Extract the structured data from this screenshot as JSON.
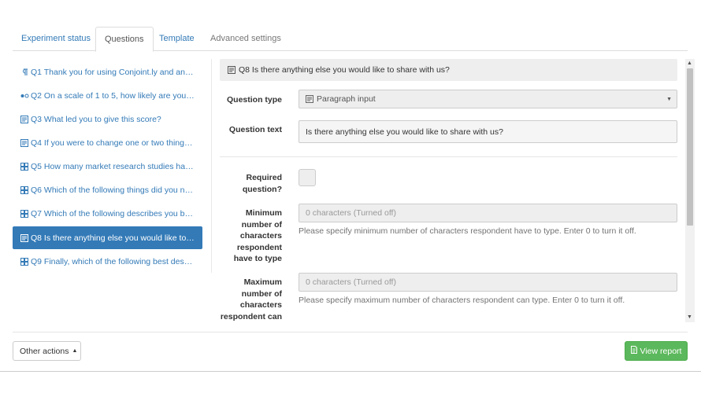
{
  "tabs": [
    {
      "label": "Experiment status"
    },
    {
      "label": "Questions"
    },
    {
      "label": "Template"
    },
    {
      "label": "Advanced settings"
    }
  ],
  "questions": [
    {
      "icon": "pilcrow-icon",
      "label": "Q1 Thank you for using Conjoint.ly and ans…"
    },
    {
      "icon": "scale-icon",
      "label": "Q2 On a scale of 1 to 5, how likely are you …"
    },
    {
      "icon": "paragraph-icon",
      "label": "Q3 What led you to give this score?"
    },
    {
      "icon": "paragraph-icon",
      "label": "Q4 If you were to change one or two things…"
    },
    {
      "icon": "choice-grid-icon",
      "label": "Q5 How many market research studies hav…"
    },
    {
      "icon": "choice-grid-icon",
      "label": "Q6 Which of the following things did you ne…"
    },
    {
      "icon": "choice-grid-icon",
      "label": "Q7 Which of the following describes you be…"
    },
    {
      "icon": "paragraph-icon",
      "label": "Q8 Is there anything else you would like to …"
    },
    {
      "icon": "choice-grid-icon",
      "label": "Q9 Finally, which of the following best desc…"
    }
  ],
  "selected_question": {
    "header": "Q8 Is there anything else you would like to share with us?",
    "question_type_label": "Question type",
    "question_type_value": "Paragraph input",
    "question_text_label": "Question text",
    "question_text_value": "Is there anything else you would like to share with us?",
    "required_label": [
      "Required",
      "question?"
    ],
    "min_label": [
      "Minimum",
      "number of",
      "characters",
      "respondent",
      "have to type"
    ],
    "min_value": "0 characters (Turned off)",
    "min_help": "Please specify minimum number of characters respondent have to type. Enter 0 to turn it off.",
    "max_label": [
      "Maximum",
      "number of",
      "characters",
      "respondent can"
    ],
    "max_value": "0 characters (Turned off)",
    "max_help": "Please specify maximum number of characters respondent can type. Enter 0 to turn it off."
  },
  "footer": {
    "other_actions": "Other actions",
    "view_report": "View report"
  },
  "colors": {
    "link": "#337ab7",
    "active_bg": "#337ab7",
    "success": "#5cb85c"
  }
}
